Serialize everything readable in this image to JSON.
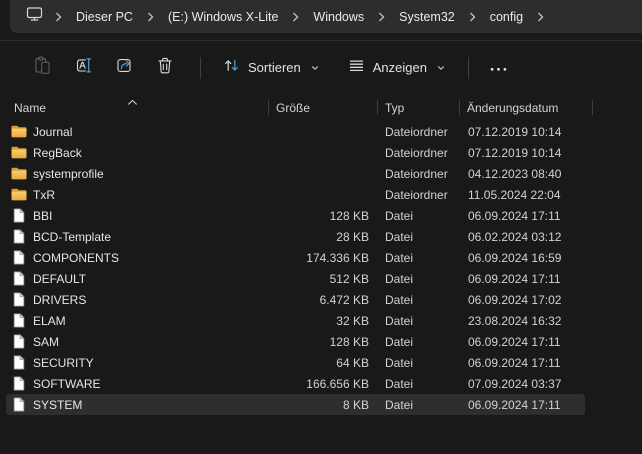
{
  "window": {
    "background_color": "#191919",
    "bar_color": "#2d2d2d",
    "accent_color": "#4aa3df",
    "selection_color": "#2e2e2e"
  },
  "breadcrumb": {
    "root_icon": "monitor-icon",
    "separator_icon": "chevron-right-icon",
    "items": [
      "Dieser PC",
      "(E:) Windows X-Lite",
      "Windows",
      "System32",
      "config"
    ]
  },
  "toolbar": {
    "icon_buttons": [
      {
        "icon": "paste-icon",
        "disabled": true
      },
      {
        "icon": "rename-icon",
        "disabled": false
      },
      {
        "icon": "share-icon",
        "disabled": false
      },
      {
        "icon": "delete-icon",
        "disabled": false
      }
    ],
    "sort_label": "Sortieren",
    "sort_icon": "sort-arrows-icon",
    "view_label": "Anzeigen",
    "view_icon": "view-lines-icon",
    "more_icon": "more-icon",
    "chevron_icon": "chevron-down-icon"
  },
  "table": {
    "headers": [
      "Name",
      "Größe",
      "Typ",
      "Änderungsdatum"
    ],
    "sort_column": "Name",
    "sort_direction": "ascending"
  },
  "rows": [
    {
      "kind": "folder",
      "name": "Journal",
      "size": "",
      "type": "Dateiordner",
      "modified": "07.12.2019 10:14",
      "selected": false
    },
    {
      "kind": "folder",
      "name": "RegBack",
      "size": "",
      "type": "Dateiordner",
      "modified": "07.12.2019 10:14",
      "selected": false
    },
    {
      "kind": "folder",
      "name": "systemprofile",
      "size": "",
      "type": "Dateiordner",
      "modified": "04.12.2023 08:40",
      "selected": false
    },
    {
      "kind": "folder",
      "name": "TxR",
      "size": "",
      "type": "Dateiordner",
      "modified": "11.05.2024 22:04",
      "selected": false
    },
    {
      "kind": "file",
      "name": "BBI",
      "size": "128 KB",
      "type": "Datei",
      "modified": "06.09.2024 17:11",
      "selected": false
    },
    {
      "kind": "file",
      "name": "BCD-Template",
      "size": "28 KB",
      "type": "Datei",
      "modified": "06.02.2024 03:12",
      "selected": false
    },
    {
      "kind": "file",
      "name": "COMPONENTS",
      "size": "174.336 KB",
      "type": "Datei",
      "modified": "06.09.2024 16:59",
      "selected": false
    },
    {
      "kind": "file",
      "name": "DEFAULT",
      "size": "512 KB",
      "type": "Datei",
      "modified": "06.09.2024 17:11",
      "selected": false
    },
    {
      "kind": "file",
      "name": "DRIVERS",
      "size": "6.472 KB",
      "type": "Datei",
      "modified": "06.09.2024 17:02",
      "selected": false
    },
    {
      "kind": "file",
      "name": "ELAM",
      "size": "32 KB",
      "type": "Datei",
      "modified": "23.08.2024 16:32",
      "selected": false
    },
    {
      "kind": "file",
      "name": "SAM",
      "size": "128 KB",
      "type": "Datei",
      "modified": "06.09.2024 17:11",
      "selected": false
    },
    {
      "kind": "file",
      "name": "SECURITY",
      "size": "64 KB",
      "type": "Datei",
      "modified": "06.09.2024 17:11",
      "selected": false
    },
    {
      "kind": "file",
      "name": "SOFTWARE",
      "size": "166.656 KB",
      "type": "Datei",
      "modified": "07.09.2024 03:37",
      "selected": false
    },
    {
      "kind": "file",
      "name": "SYSTEM",
      "size": "8 KB",
      "type": "Datei",
      "modified": "06.09.2024 17:11",
      "selected": true
    }
  ]
}
